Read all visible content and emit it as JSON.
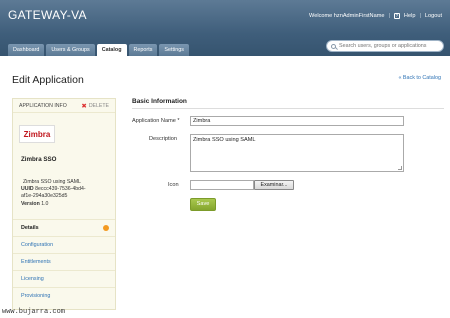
{
  "header": {
    "brand": "GATEWAY-VA",
    "welcome": "Welcome hznAdminFirstName",
    "help_label": "Help",
    "logout_label": "Logout"
  },
  "tabs": [
    {
      "label": "Dashboard",
      "active": false
    },
    {
      "label": "Users & Groups",
      "active": false
    },
    {
      "label": "Catalog",
      "active": true
    },
    {
      "label": "Reports",
      "active": false
    },
    {
      "label": "Settings",
      "active": false
    }
  ],
  "search": {
    "placeholder": "Search users, groups or applications",
    "value": ""
  },
  "page": {
    "title": "Edit Application",
    "back_link": "« Back to Catalog"
  },
  "left_panel": {
    "info_label": "APPLICATION INFO",
    "delete_label": "DELETE",
    "logo_text": "Zimbra",
    "app_name": "Zimbra SSO",
    "description": "Zimbra SSO using SAML",
    "uuid_label": "UUID",
    "uuid_line1": "8eccc439-7536-4bd4-",
    "uuid_line2": "af1e-294a30e325d5",
    "version_label": "Version",
    "version_value": "1.0",
    "nav": [
      {
        "label": "Details",
        "active": true
      },
      {
        "label": "Configuration",
        "active": false
      },
      {
        "label": "Entitlements",
        "active": false
      },
      {
        "label": "Licensing",
        "active": false
      },
      {
        "label": "Provisioning",
        "active": false
      }
    ]
  },
  "form": {
    "section_title": "Basic Information",
    "name_label": "Application Name *",
    "name_value": "Zimbra",
    "description_label": "Description",
    "description_value": "Zimbra SSO using SAML",
    "icon_label": "Icon",
    "browse_label": "Examinar...",
    "save_label": "Save"
  },
  "watermark": "www.bujarra.com",
  "colors": {
    "header": "#3f5e7b",
    "accent_link": "#2f73b5",
    "save_button": "#8fb03a",
    "nav_dot": "#f39a22"
  }
}
